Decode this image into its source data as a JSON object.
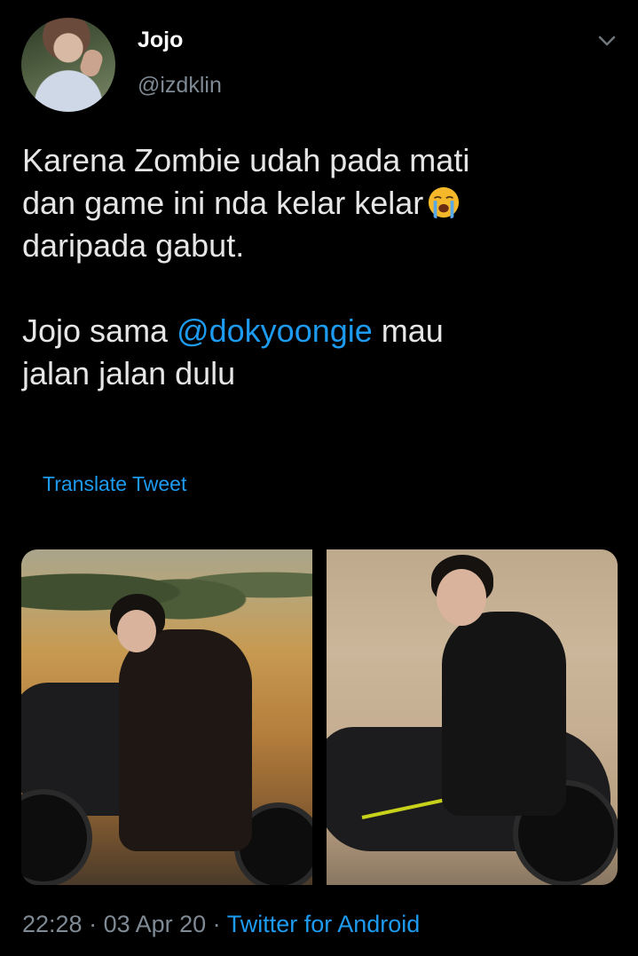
{
  "tweet": {
    "display_name": "Jojo",
    "handle": "@izdklin",
    "text_line1": "Karena Zombie udah pada mati",
    "text_line2": "dan game ini nda kelar kelar",
    "text_line3": "daripada gabut.",
    "text_line4_pre": "Jojo sama ",
    "mention": "@dokyoongie",
    "text_line4_post": " mau",
    "text_line5": "jalan jalan dulu",
    "translate_label": "Translate Tweet",
    "time": "22:28",
    "separator": " · ",
    "date": "03 Apr 20",
    "source": "Twitter for Android"
  },
  "icons": {
    "menu": "chevron-down-icon",
    "emoji": "loudly-crying-face-emoji"
  },
  "colors": {
    "background": "#000000",
    "link": "#1d9bf0",
    "muted": "#7f8a95",
    "text": "#e6e6e6"
  }
}
